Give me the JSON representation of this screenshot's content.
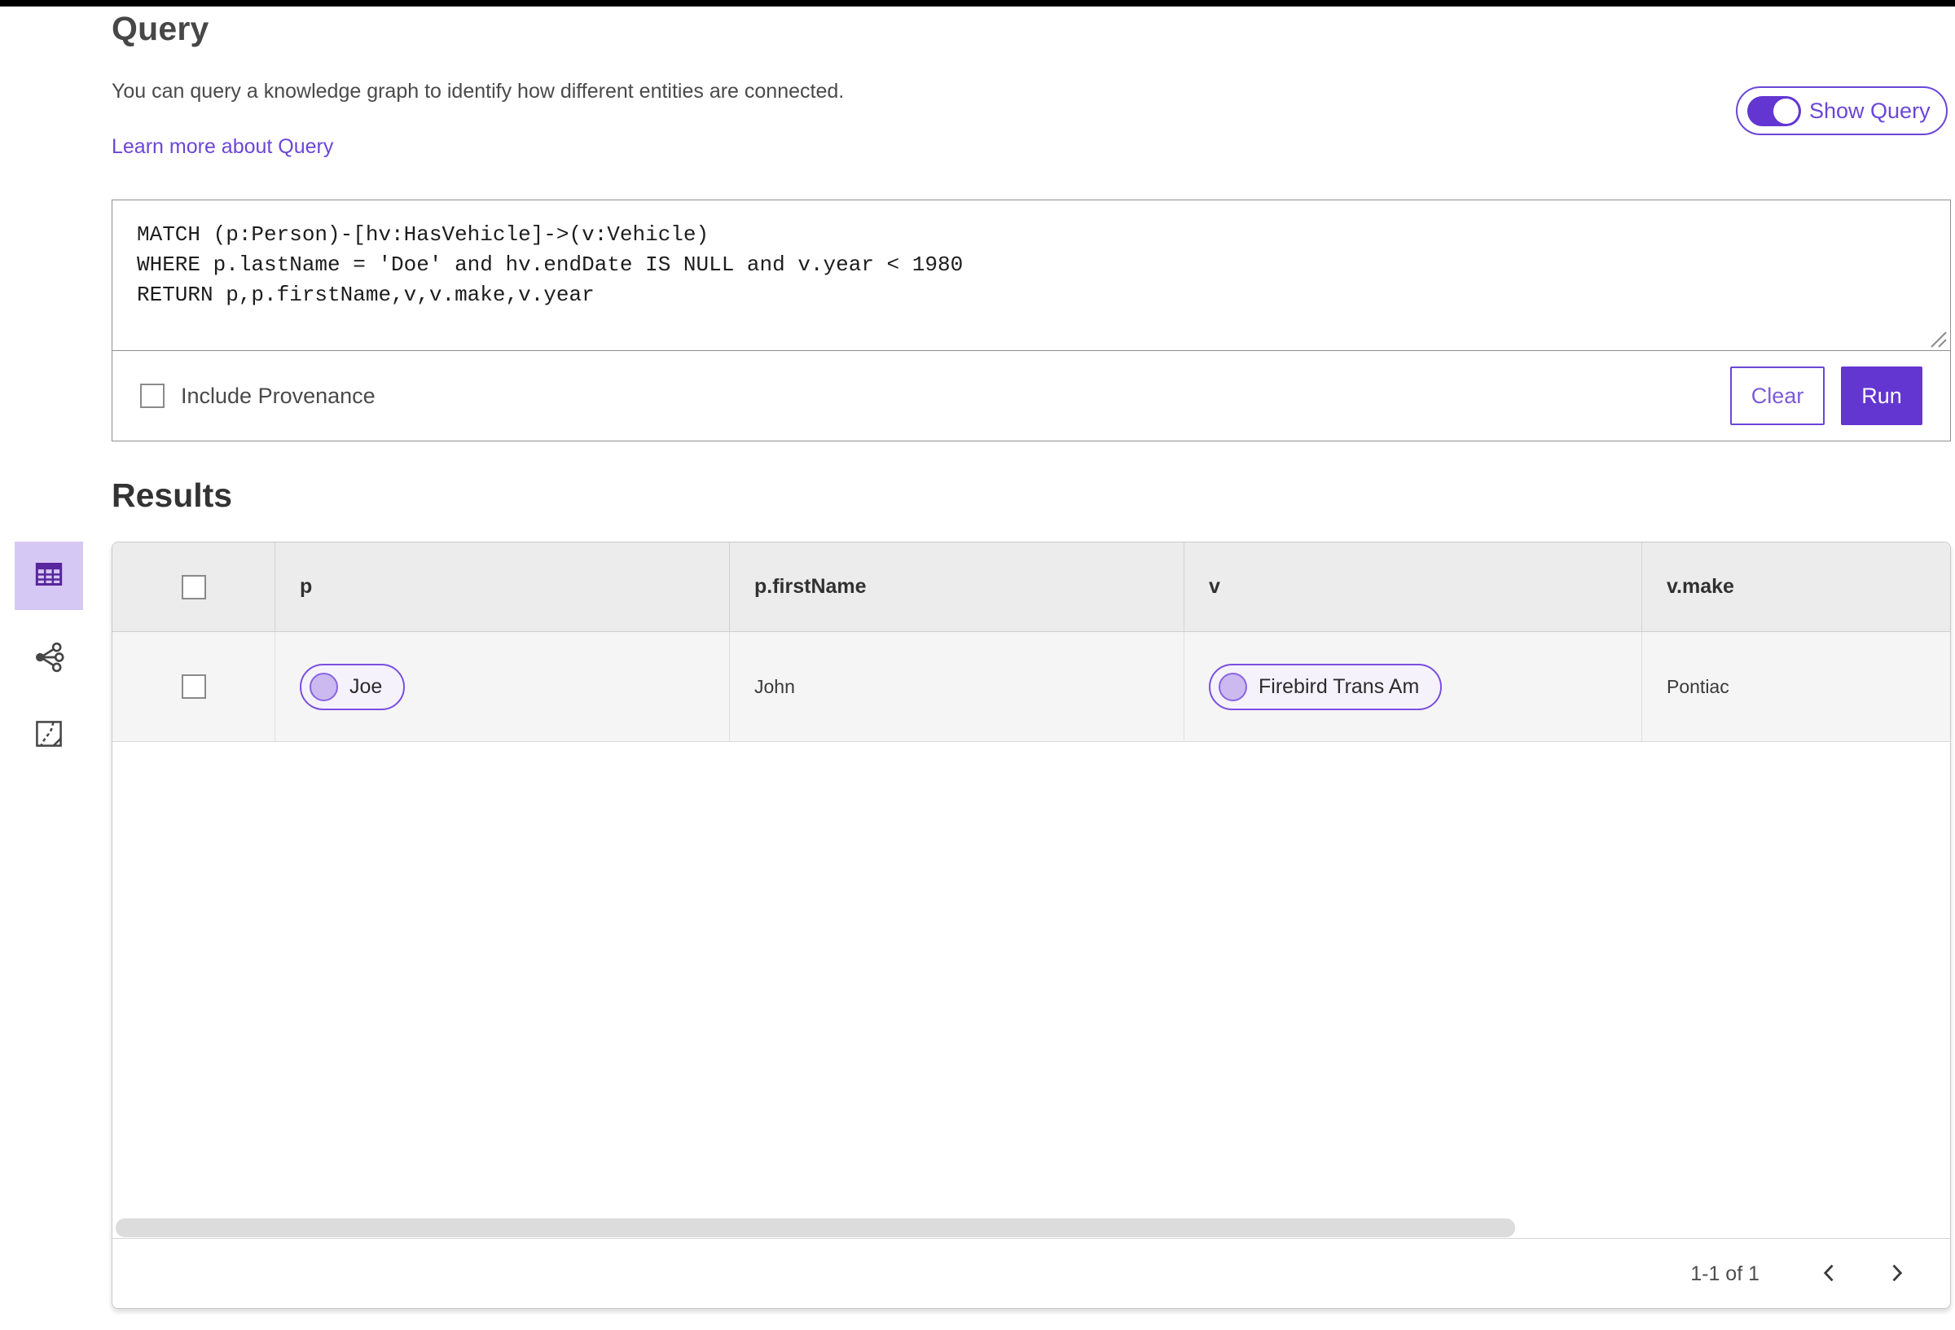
{
  "header": {
    "title": "Query",
    "description": "You can query a knowledge graph to identify how different entities are connected.",
    "learn_more_link": "Learn more about Query",
    "show_query_label": "Show Query",
    "show_query_on": true
  },
  "query_editor": {
    "code": "MATCH (p:Person)-[hv:HasVehicle]->(v:Vehicle)\nWHERE p.lastName = 'Doe' and hv.endDate IS NULL and v.year < 1980\nRETURN p,p.firstName,v,v.make,v.year",
    "include_provenance_label": "Include Provenance",
    "include_provenance_checked": false,
    "clear_button": "Clear",
    "run_button": "Run"
  },
  "results": {
    "heading": "Results",
    "active_view": "table-view",
    "views": [
      "table-view",
      "link-chart-view",
      "map-view"
    ],
    "columns": [
      "p",
      "p.firstName",
      "v",
      "v.make"
    ],
    "rows": [
      {
        "p": "Joe",
        "p_firstName": "John",
        "v": "Firebird Trans Am",
        "v_make": "Pontiac"
      }
    ],
    "row_selected": false,
    "pagination": {
      "range_label": "1-1 of 1"
    }
  },
  "colors": {
    "accent_purple": "#6336d2",
    "link_purple": "#6b46d8",
    "pill_border": "#7a4fe0",
    "pill_bg": "#f5f2fc",
    "selected_view_bg": "#d6c8f5",
    "table_header_bg": "#ececec",
    "table_row_bg": "#f5f5f5",
    "top_bar": "#000000"
  }
}
